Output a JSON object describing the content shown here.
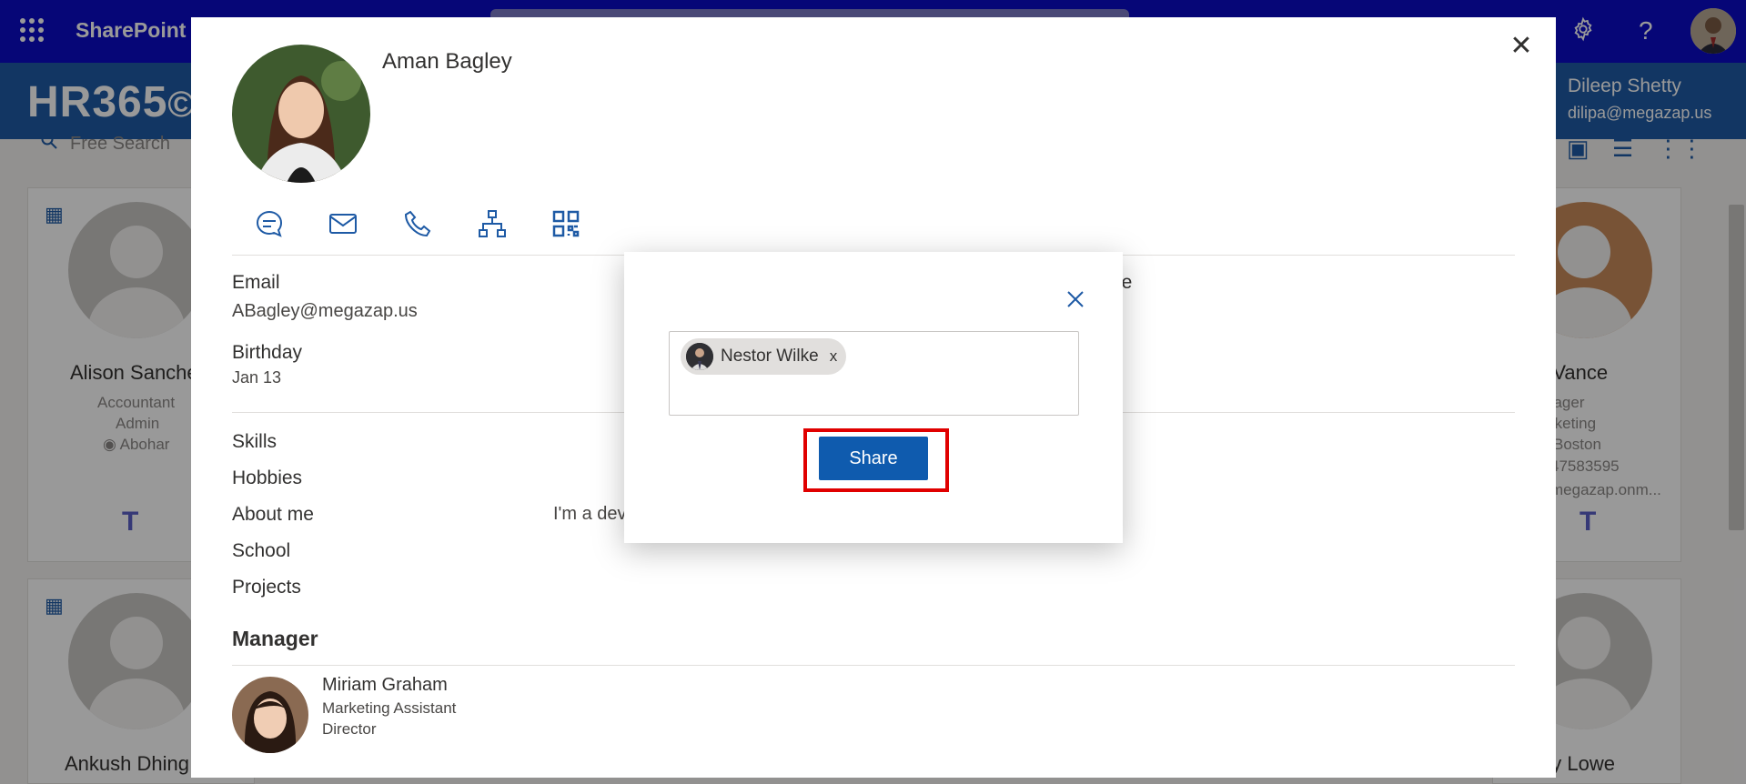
{
  "suite_bar": {
    "app_name": "SharePoint",
    "icons": [
      "waffle-icon",
      "gear-icon",
      "help-icon",
      "account-avatar"
    ]
  },
  "hr_header": {
    "logo_text": "HR365",
    "user_name": "Dileep Shetty",
    "user_email": "dilipa@megazap.us"
  },
  "directory": {
    "search_placeholder": "Free Search",
    "cards": [
      {
        "name": "Alison Sanche",
        "title": "Accountant",
        "department": "Admin",
        "location": "Abohar"
      },
      {
        "name": "e Vance",
        "title": "nager",
        "department": "rketing",
        "location": "Boston",
        "phone": "47583595",
        "email": "megazap.onm..."
      },
      {
        "name": "Ankush Dhing",
        "title": "",
        "department": "",
        "location": ""
      },
      {
        "name": "ey Lowe",
        "title": "",
        "department": "",
        "location": ""
      }
    ]
  },
  "profile": {
    "name": "Aman Bagley",
    "actions": [
      "chat-icon",
      "mail-icon",
      "phone-icon",
      "org-chart-icon",
      "qr-code-icon"
    ],
    "email_label": "Email",
    "email_value": "ABagley@megazap.us",
    "birthday_label": "Birthday",
    "birthday_value": "Jan 13",
    "partial_label": "le",
    "skills_label": "Skills",
    "hobbies_label": "Hobbies",
    "about_label": "About me",
    "about_value": "I'm a dev",
    "school_label": "School",
    "projects_label": "Projects",
    "manager_heading": "Manager",
    "manager": {
      "name": "Miriam Graham",
      "title": "Marketing Assistant",
      "role": "Director"
    }
  },
  "share_dialog": {
    "recipient": "Nestor Wilke",
    "remove_glyph": "x",
    "share_label": "Share",
    "highlight_color": "#e00000"
  },
  "colors": {
    "suite_bar": "#0b0bc7",
    "hr_header": "#1e5aa5",
    "share_button": "#0f5bae"
  }
}
